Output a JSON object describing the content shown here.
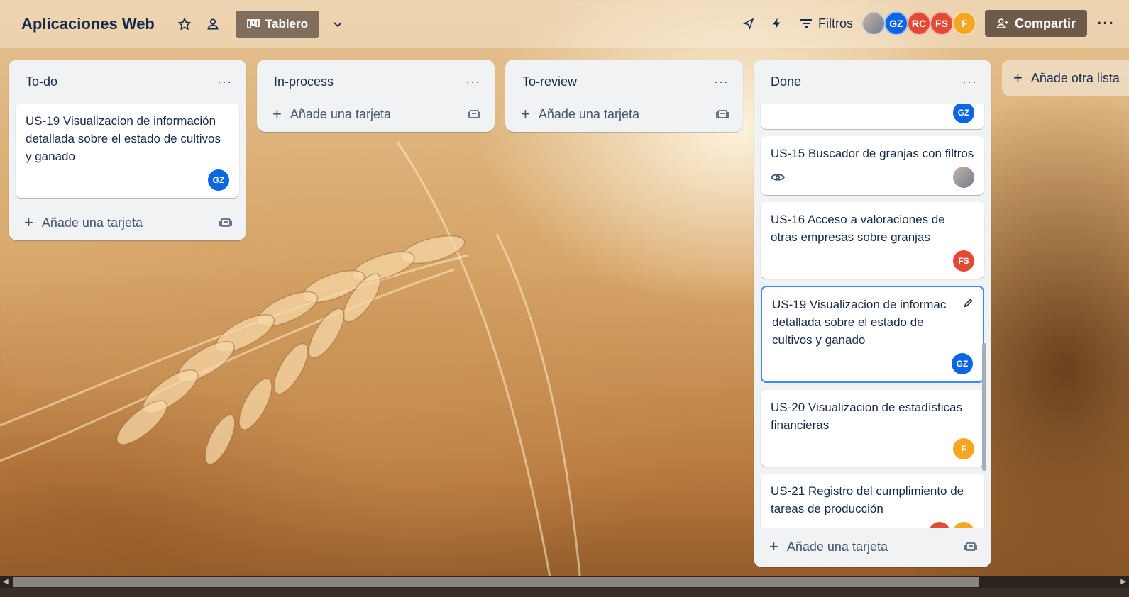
{
  "board": {
    "title": "Aplicaciones Web",
    "view_label": "Tablero",
    "filters_label": "Filtros",
    "share_label": "Compartir",
    "add_list_label": "Añade otra lista"
  },
  "members": [
    {
      "initials": "",
      "color": "#8a9ab0",
      "photo": true
    },
    {
      "initials": "GZ",
      "color": "#0c66e4"
    },
    {
      "initials": "RC",
      "color": "#e34935"
    },
    {
      "initials": "FS",
      "color": "#e34935"
    },
    {
      "initials": "F",
      "color": "#f5a623"
    }
  ],
  "lists": [
    {
      "title": "To-do",
      "add_card_label": "Añade una tarjeta",
      "cards": [
        {
          "title": "US-19 Visualizacion de información detallada sobre el estado de cultivos y ganado",
          "members": [
            "GZ"
          ]
        }
      ]
    },
    {
      "title": "In-process",
      "add_card_label": "Añade una tarjeta",
      "cards": []
    },
    {
      "title": "To-review",
      "add_card_label": "Añade una tarjeta",
      "cards": []
    },
    {
      "title": "Done",
      "add_card_label": "Añade una tarjeta",
      "cards": [
        {
          "title": "",
          "members": [
            "GZ"
          ]
        },
        {
          "title": "US-15 Buscador de granjas con filtros",
          "members": [
            "photo"
          ],
          "watching": true
        },
        {
          "title": "US-16 Acceso a valoraciones de otras empresas sobre granjas",
          "members": [
            "FS"
          ]
        },
        {
          "title": "US-19 Visualizacion de informac detallada sobre el estado de cultivos y ganado",
          "members": [
            "GZ"
          ],
          "selected": true
        },
        {
          "title": "US-20 Visualizacion de estadísticas financieras",
          "members": [
            "F"
          ]
        },
        {
          "title": "US-21 Registro del cumplimiento de tareas de producción",
          "members": [
            "FS",
            "F"
          ]
        }
      ]
    }
  ],
  "colors": {
    "gz": "#0c66e4",
    "fs": "#e34935",
    "f": "#f5a623",
    "selected_border": "#388bff"
  }
}
